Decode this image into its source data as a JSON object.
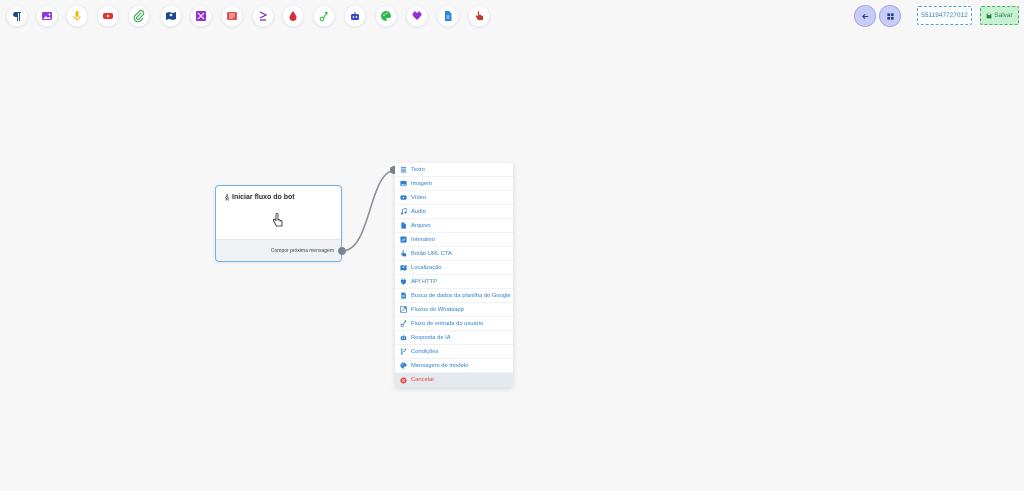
{
  "toolbar": {
    "tools": [
      {
        "icon": "paragraph-icon",
        "color": "#1f4b8e"
      },
      {
        "icon": "image-icon",
        "color": "#8e3ad8"
      },
      {
        "icon": "microphone-icon",
        "color": "#f2b700"
      },
      {
        "icon": "video-icon",
        "color": "#e0342f"
      },
      {
        "icon": "paperclip-icon",
        "color": "#3aa54d"
      },
      {
        "icon": "map-icon",
        "color": "#1f4b8e"
      },
      {
        "icon": "interactive-icon",
        "color": "#9a2fd0"
      },
      {
        "icon": "list-icon",
        "color": "#e2514a"
      },
      {
        "icon": "api-icon",
        "color": "#7b2ab8"
      },
      {
        "icon": "drop-icon",
        "color": "#d72c3c"
      },
      {
        "icon": "flow-icon",
        "color": "#36b24b"
      },
      {
        "icon": "robot-icon",
        "color": "#3845c8"
      },
      {
        "icon": "palette-icon",
        "color": "#2fb74f"
      },
      {
        "icon": "heart-icon",
        "color": "#9a2fd0"
      },
      {
        "icon": "file-icon",
        "color": "#2d86d6"
      },
      {
        "icon": "hand-pointer-icon",
        "color": "#c0392b"
      }
    ],
    "phone": "5511947727012",
    "save_label": "Salvar"
  },
  "start_node": {
    "title": "Iniciar fluxo do bot",
    "footer": "Compor próxima mensagem"
  },
  "menu": {
    "items": [
      {
        "label": "Texto",
        "icon": "text-icon"
      },
      {
        "label": "Imagem",
        "icon": "image-icon"
      },
      {
        "label": "Vídeo",
        "icon": "video-icon"
      },
      {
        "label": "Áudio",
        "icon": "music-icon"
      },
      {
        "label": "Arquivo",
        "icon": "file-icon"
      },
      {
        "label": "Interativo",
        "icon": "interactive-icon"
      },
      {
        "label": "Botão URL CTA",
        "icon": "hand-pointer-icon"
      },
      {
        "label": "Localização",
        "icon": "map-icon"
      },
      {
        "label": "API HTTP",
        "icon": "plug-icon"
      },
      {
        "label": "Busca de dados da planilha do Google",
        "icon": "sheet-icon"
      },
      {
        "label": "Fluxos do Whatsapp",
        "icon": "flow-icon"
      },
      {
        "label": "Fluxo de entrada do usuário",
        "icon": "user-flow-icon"
      },
      {
        "label": "Resposta de IA",
        "icon": "robot-icon"
      },
      {
        "label": "Condições",
        "icon": "branch-icon"
      },
      {
        "label": "Mensagem de modelo",
        "icon": "palette-icon"
      }
    ],
    "cancel_label": "Cancelar",
    "cancel_icon": "close-icon"
  },
  "colors": {
    "accent": "#2e80cf",
    "cancel": "#e8453c",
    "node_border": "#6fb3ea"
  }
}
